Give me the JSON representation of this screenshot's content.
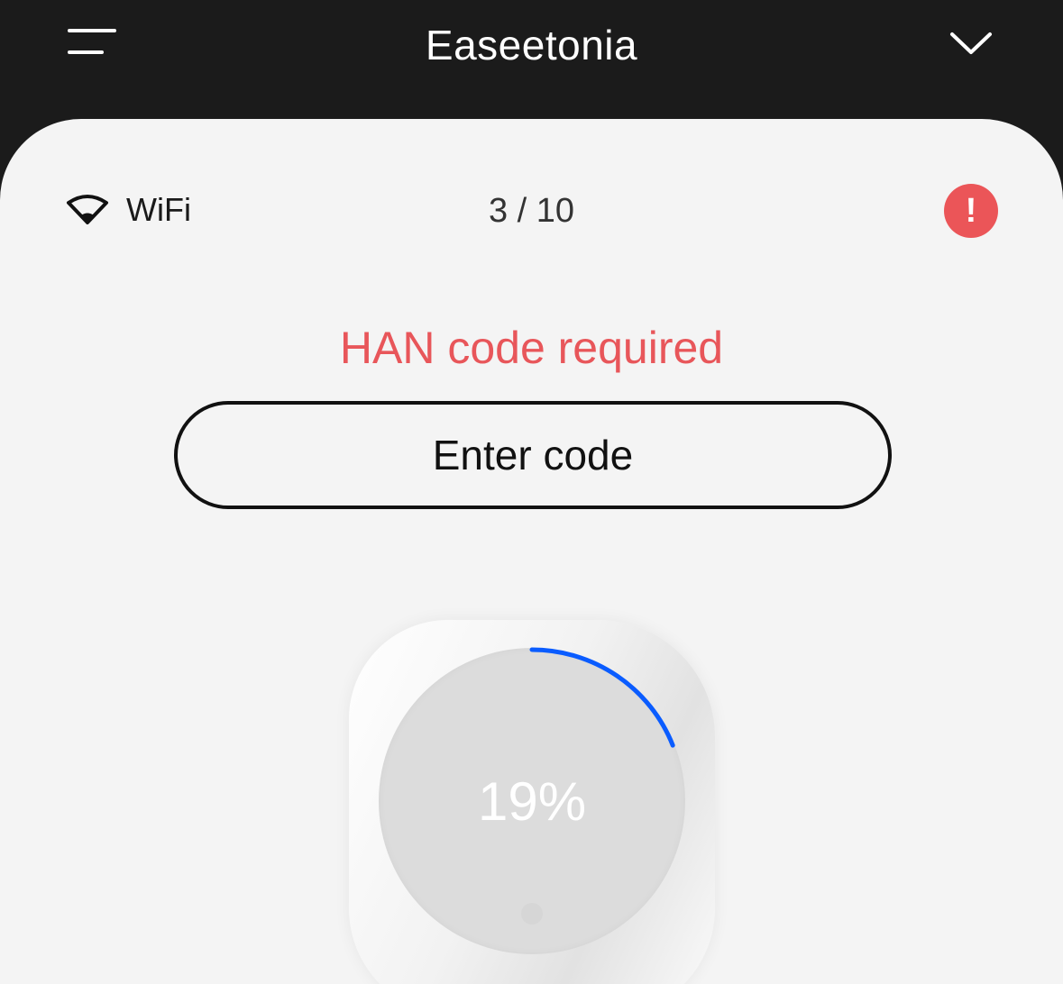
{
  "header": {
    "title": "Easeetonia",
    "menu_icon": "hamburger-menu-icon",
    "dropdown_icon": "chevron-down-icon"
  },
  "status_row": {
    "connection_label": "WiFi",
    "connection_icon": "wifi-icon",
    "counter": "3 / 10",
    "alert_symbol": "!",
    "alert_color": "#eb5558"
  },
  "han": {
    "status_text": "HAN code required",
    "status_color": "#e8565a",
    "button_label": "Enter code"
  },
  "charger": {
    "progress_label": "19%",
    "progress_fraction": 0.19,
    "arc_color": "#0a5cff"
  }
}
